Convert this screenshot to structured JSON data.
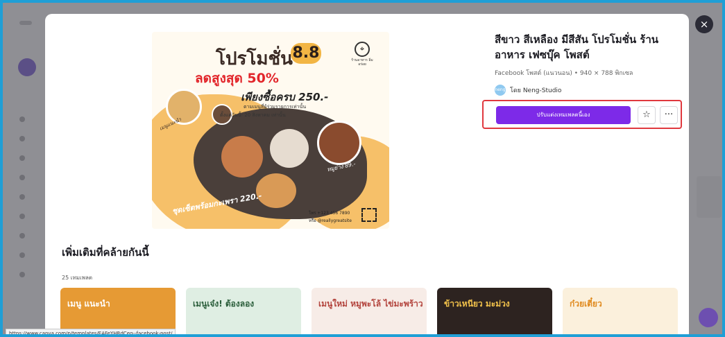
{
  "template": {
    "title": "สีขาว สีเหลือง มีสีสัน โปรโมชั่น ร้านอาหาร เฟซบุ๊ค โพสต์",
    "meta": "Facebook โพสต์ (แนวนอน) • 940 × 788 พิกเซล",
    "author_prefix": "โดย Neng-Studio",
    "author_initials": "neng"
  },
  "actions": {
    "customize_label": "ปรับแต่งเทมเพลตนี้เอง",
    "favorite_icon": "☆",
    "more_icon": "···",
    "close_icon": "×"
  },
  "poster": {
    "title": "โปรโมชั่น",
    "badge": "8.8",
    "subtitle": "ลดสูงสุด 50%",
    "line3": "เพียงซื้อครบ 250.-",
    "line4": "ตามเมนูที่ผู้ร่วมรายการเท่านั้น",
    "line5": "ตั้งแต่วันนี้- 20 สิงหาคม เท่านั้น",
    "logo_text": "ร้านอาหาร อิ่มอร่อย",
    "price_set": "ชุดเซ็ตพร้อมกะเพรา 220.-",
    "price_pork": "หมูย่าง 89.-",
    "left_label": "เมนูแนะนำ",
    "contact1": "โทร +123 456 7890",
    "contact2": "หรือ @reallygreatsite"
  },
  "similar": {
    "title": "เพิ่มเติมที่คล้ายกันนี้",
    "count": "25 เทมเพลต",
    "thumbs": [
      {
        "text": "เมนู แนะนำ",
        "bg": "#e69a34",
        "fg": "#ffffff"
      },
      {
        "text": "เมนูเจ๋ง! ต้องลอง",
        "bg": "#dfeee3",
        "fg": "#2a5d3a"
      },
      {
        "text": "เมนูใหม่ หมูพะโล้ ไข่มะพร้าว",
        "bg": "#f7ece7",
        "fg": "#b3443d"
      },
      {
        "text": "ข้าวเหนียว มะม่วง",
        "bg": "#2d2320",
        "fg": "#f2c24b"
      },
      {
        "text": "ก๋วยเตี๋ยว",
        "bg": "#fbf0dc",
        "fg": "#e08a1e"
      }
    ]
  },
  "status_url": "https://www.canva.com/p/templates/EAFeYHRdCeg--facebook-post/"
}
